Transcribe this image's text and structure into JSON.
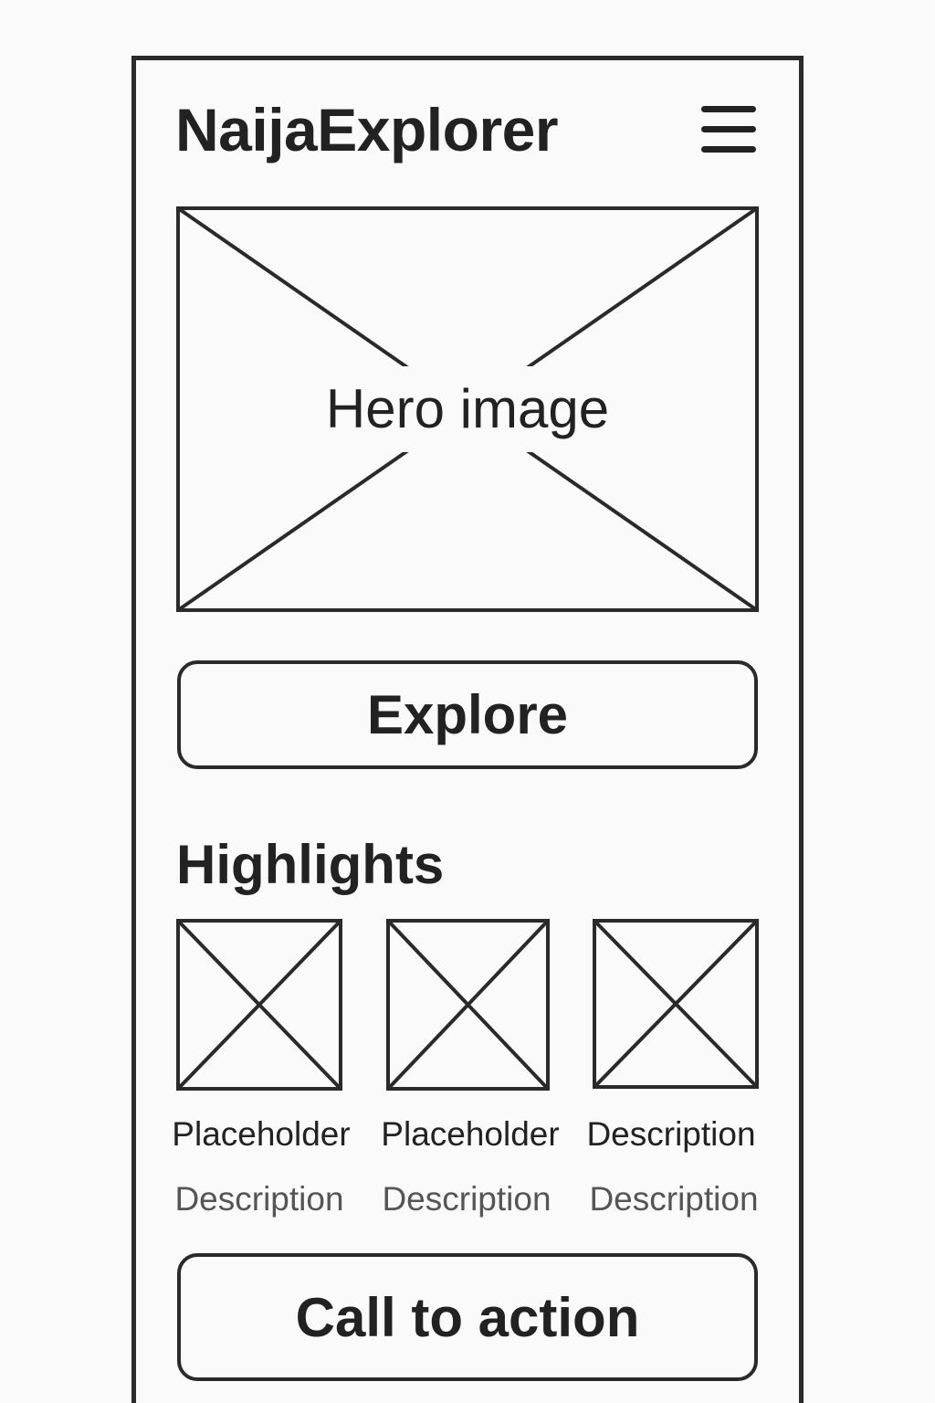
{
  "header": {
    "app_title": "NaijaExplorer",
    "menu_icon": "hamburger-menu-icon"
  },
  "hero": {
    "label": "Hero image"
  },
  "explore_button": {
    "label": "Explore"
  },
  "highlights": {
    "title": "Highlights",
    "cards": [
      {
        "title": "Placeholder",
        "description": "Description"
      },
      {
        "title": "Placeholder",
        "description": "Description"
      },
      {
        "title": "Description",
        "description": "Description"
      }
    ]
  },
  "cta_button": {
    "label": "Call to action"
  },
  "colors": {
    "stroke": "#2a2a2a",
    "background": "#fafafa",
    "text": "#222222",
    "muted_text": "#555555"
  }
}
